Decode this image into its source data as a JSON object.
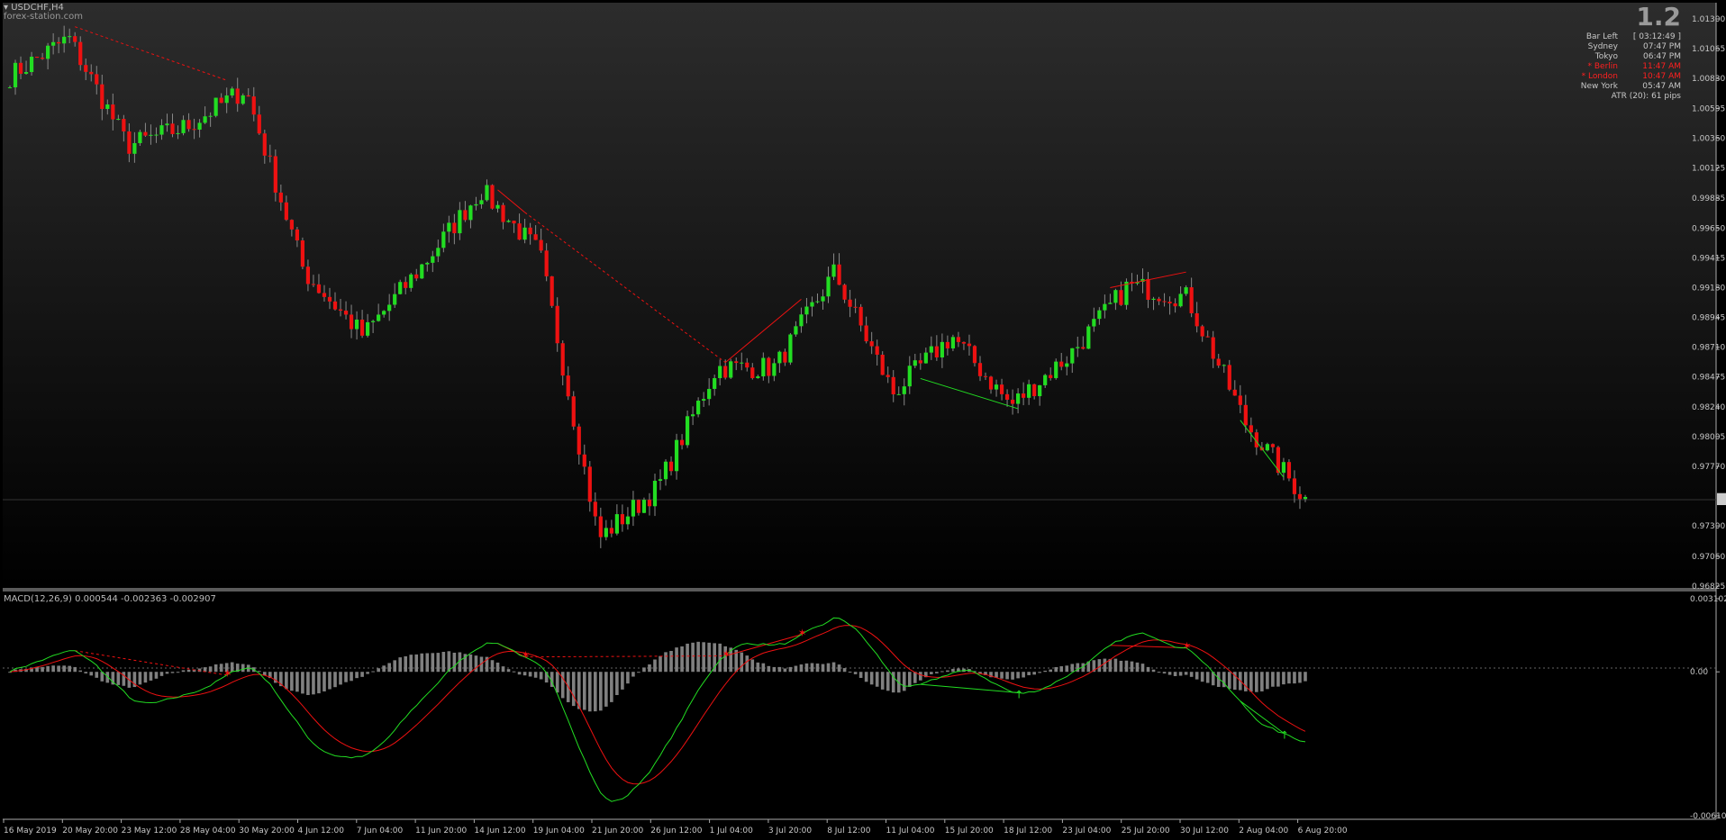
{
  "header": {
    "symbol": "USDCHF,H4",
    "watermark": "forex-station.com"
  },
  "info_panel": {
    "spread": "1.2",
    "rows": [
      {
        "label": "Bar Left",
        "value": "[ 03:12:49 ]",
        "color": "#c8c8c8"
      },
      {
        "label": "Sydney",
        "value": "07:47 PM",
        "color": "#c8c8c8"
      },
      {
        "label": "Tokyo",
        "value": "06:47 PM",
        "color": "#c8c8c8"
      },
      {
        "label": "* Berlin",
        "value": "11:47 AM",
        "color": "#ff2020"
      },
      {
        "label": "* London",
        "value": "10:47 AM",
        "color": "#ff2020"
      },
      {
        "label": "New York",
        "value": "05:47 AM",
        "color": "#c8c8c8"
      }
    ],
    "atr": "ATR (20): 61 pips"
  },
  "indicator": {
    "label": "MACD(12,26,9) 0.000544 -0.002363 -0.002907"
  },
  "price_axis": {
    "ticks": [
      "1.01300",
      "1.01065",
      "1.00830",
      "1.00595",
      "1.00360",
      "1.00125",
      "0.99885",
      "0.99650",
      "0.99415",
      "0.99180",
      "0.98945",
      "0.98710",
      "0.98475",
      "0.98240",
      "0.98005",
      "0.97770",
      "0.97300",
      "0.97060",
      "0.96825"
    ],
    "current_price": "0.97509"
  },
  "macd_axis": {
    "ticks": [
      "0.003102",
      "0.00",
      "-0.006102"
    ]
  },
  "time_axis": {
    "ticks": [
      "16 May 2019",
      "20 May 20:00",
      "23 May 12:00",
      "28 May 04:00",
      "30 May 20:00",
      "4 Jun 12:00",
      "7 Jun 04:00",
      "11 Jun 20:00",
      "14 Jun 12:00",
      "19 Jun 04:00",
      "21 Jun 20:00",
      "26 Jun 12:00",
      "1 Jul 04:00",
      "3 Jul 20:00",
      "8 Jul 12:00",
      "11 Jul 04:00",
      "15 Jul 20:00",
      "18 Jul 12:00",
      "23 Jul 04:00",
      "25 Jul 20:00",
      "30 Jul 12:00",
      "2 Aug 04:00",
      "6 Aug 20:00"
    ]
  },
  "colors": {
    "bull": "#22dd22",
    "bear": "#ee1111",
    "macd_line": "#22dd22",
    "signal_line": "#ee1111",
    "histogram": "#808080",
    "background_top": "#2c2c2c",
    "background_bottom": "#000000"
  },
  "chart_data": {
    "type": "candlestick",
    "symbol": "USDCHF",
    "timeframe": "H4",
    "ylim": [
      0.96825,
      1.013
    ],
    "close_path": [
      [
        "16 May 2019",
        1.0085
      ],
      [
        "20 May 20:00",
        1.0115
      ],
      [
        "23 May 12:00",
        1.003
      ],
      [
        "28 May 04:00",
        1.0045
      ],
      [
        "30 May 20:00",
        1.0075
      ],
      [
        "4 Jun 12:00",
        0.993
      ],
      [
        "7 Jun 04:00",
        0.988
      ],
      [
        "11 Jun 20:00",
        0.9935
      ],
      [
        "14 Jun 12:00",
        0.9995
      ],
      [
        "19 Jun 04:00",
        0.9945
      ],
      [
        "21 Jun 20:00",
        0.972
      ],
      [
        "26 Jun 12:00",
        0.976
      ],
      [
        "1 Jul 04:00",
        0.9855
      ],
      [
        "3 Jul 20:00",
        0.9855
      ],
      [
        "8 Jul 12:00",
        0.993
      ],
      [
        "11 Jul 04:00",
        0.9835
      ],
      [
        "15 Jul 20:00",
        0.988
      ],
      [
        "18 Jul 12:00",
        0.9825
      ],
      [
        "23 Jul 04:00",
        0.9865
      ],
      [
        "25 Jul 20:00",
        0.992
      ],
      [
        "30 Jul 12:00",
        0.991
      ],
      [
        "2 Aug 04:00",
        0.981
      ],
      [
        "6 Aug 20:00",
        0.9751
      ]
    ],
    "current_price": 0.97509,
    "macd": {
      "macd": 0.000544,
      "signal": -0.002363,
      "histogram": -0.002907,
      "ylim": [
        -0.006102,
        0.003102
      ]
    }
  }
}
